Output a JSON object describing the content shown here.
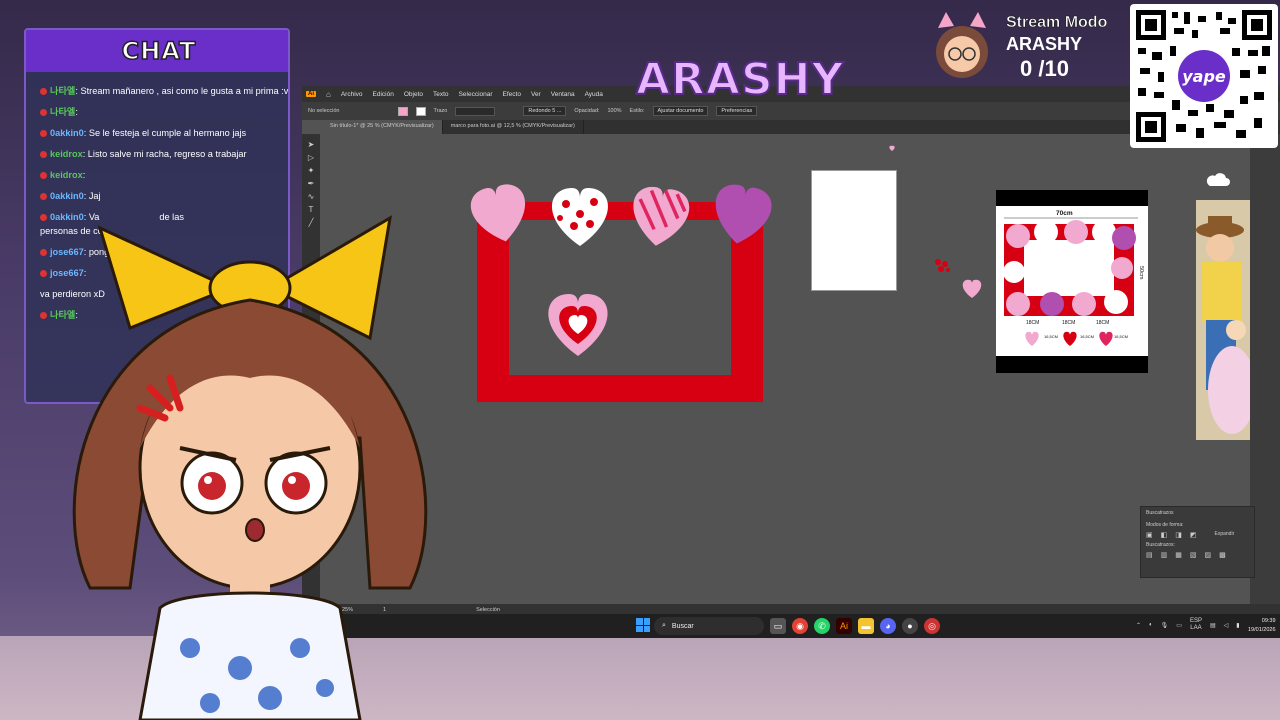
{
  "chat": {
    "title": "CHAT",
    "messages": [
      {
        "user": "나타엘",
        "text": ": Stream mañanero , asi como le gusta a mi prima :v",
        "color": "#57c75a"
      },
      {
        "user": "나타엘",
        "text": ":",
        "color": "#57c75a"
      },
      {
        "user": "0akkin0",
        "text": ": Se le festeja el cumple al hermano jajs",
        "color": "#6bb7ff"
      },
      {
        "user": "keidrox",
        "text": ": Listo salve mi racha, regreso a trabajar",
        "color": "#57c75a"
      },
      {
        "user": "keidrox",
        "text": ":",
        "color": "#57c75a"
      },
      {
        "user": "0akkin0",
        "text": ": Jaj",
        "color": "#6bb7ff"
      },
      {
        "user": "0akkin0",
        "text": ": Va",
        "color": "#6bb7ff"
      },
      {
        "user": "jose667",
        "text": ": pong",
        "color": "#6bb7ff"
      },
      {
        "user": "jose667",
        "text": ":",
        "color": "#6bb7ff"
      },
      {
        "user": "",
        "text": "va perdieron xD",
        "color": "#ffffff"
      },
      {
        "user": "나타엘",
        "text": ":",
        "color": "#57c75a"
      }
    ],
    "extra_fragments": [
      "de las",
      "personas de co"
    ]
  },
  "brand": {
    "title": "ARASHY"
  },
  "stream": {
    "mode_label": "Stream Modo",
    "name": "ARASHY",
    "counter": "0 /10"
  },
  "qr": {
    "label": "yape"
  },
  "ai": {
    "menu": [
      "Archivo",
      "Edición",
      "Objeto",
      "Texto",
      "Seleccionar",
      "Efecto",
      "Ver",
      "Ventana",
      "Ayuda"
    ],
    "control": {
      "selection": "No selección",
      "stroke": "Trazo",
      "opacity_label": "Opacidad:",
      "opacity": "100%",
      "style_label": "Estilo:",
      "shape": "Redondo 5 ...",
      "doc_setup": "Ajustar documento",
      "prefs": "Preferencias"
    },
    "tabs": [
      "Sin título-1* @ 25 % (CMYK/Previsualizar)",
      "marco para foto.ai @ 12,5 % (CMYK/Previsualizar)"
    ],
    "status": {
      "zoom": "25%",
      "page": "1",
      "tool": "Selección"
    },
    "pathfinder": {
      "title": "Buscatrazos",
      "shape_modes": "Modos de forma:",
      "expand": "Expandir",
      "finders": "Buscatrazos:"
    },
    "mockup": {
      "width_label": "70cm",
      "height_label": "50cm",
      "sizes": [
        "18CM",
        "18CM",
        "18CM"
      ],
      "side_sizes": [
        "16,5CM",
        "16,5CM",
        "16,5CM"
      ]
    }
  },
  "taskbar": {
    "search": "Buscar",
    "lang": "ESP",
    "region": "LAA",
    "time": "09:39",
    "date": "19/01/2026"
  }
}
